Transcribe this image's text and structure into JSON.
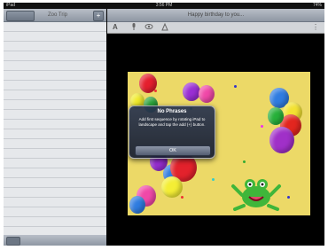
{
  "status_bar": {
    "left": "iPad",
    "center": "3:56 PM",
    "right": "74%"
  },
  "sidebar": {
    "title": "Zoo Trip",
    "add_label": "+"
  },
  "editor": {
    "title": "Happy birthday to you..."
  },
  "toolbar": {
    "tools": [
      "A",
      "mic-icon",
      "eye-icon",
      "clean-icon"
    ],
    "more": "⋮"
  },
  "alert": {
    "title": "No Phrases",
    "message": "Add first sequence by rotating iPad to landscape and tap the add (+) button.",
    "ok_label": "OK"
  },
  "colors": {
    "artwork_bg": "#ecd967",
    "nav_gradient_top": "#b8bec7",
    "nav_gradient_bottom": "#8e97a3"
  }
}
